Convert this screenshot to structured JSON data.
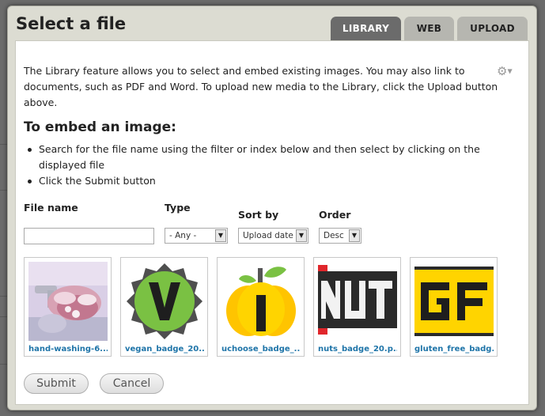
{
  "dialog": {
    "title": "Select a file",
    "tabs": [
      {
        "label": "LIBRARY",
        "active": true
      },
      {
        "label": "WEB",
        "active": false
      },
      {
        "label": "UPLOAD",
        "active": false
      }
    ]
  },
  "intro": "The Library feature allows you to select and embed existing images. You may also link to documents, such as PDF and Word. To upload new media to the Library, click the Upload button above.",
  "heading": "To embed an image:",
  "steps": [
    "Search for the file name using the filter or index below and then select by clicking on the displayed file",
    "Click the Submit button"
  ],
  "filters": {
    "file_name_label": "File name",
    "file_name_value": "",
    "type_label": "Type",
    "type_value": "- Any -",
    "sort_label": "Sort by",
    "sort_value": "Upload date",
    "order_label": "Order",
    "order_value": "Desc"
  },
  "files": [
    {
      "name": "hand-washing-6...",
      "icon": "hand-washing-photo"
    },
    {
      "name": "vegan_badge_20....",
      "icon": "vegan-badge-image"
    },
    {
      "name": "uchoose_badge_...",
      "icon": "uchoose-badge-image"
    },
    {
      "name": "nuts_badge_20.p...",
      "icon": "nuts-badge-image"
    },
    {
      "name": "gluten_free_badg...",
      "icon": "gluten-free-badge-image"
    }
  ],
  "buttons": {
    "submit": "Submit",
    "cancel": "Cancel"
  },
  "colors": {
    "active_tab": "#6b6b6b",
    "link": "#1e74a8",
    "vegan_green": "#7ac143",
    "badge_yellow": "#ffd400"
  }
}
